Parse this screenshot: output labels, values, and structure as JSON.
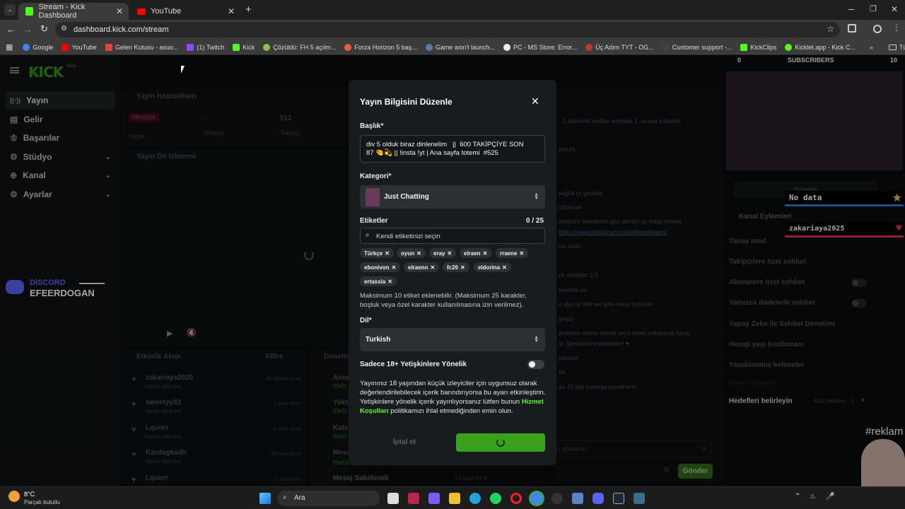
{
  "browser": {
    "tabs": [
      {
        "title": "Stream - Kick Dashboard",
        "active": true
      },
      {
        "title": "YouTube",
        "active": false
      }
    ],
    "url": "dashboard.kick.com/stream",
    "bookmarks": [
      "Google",
      "YouTube",
      "Gelen Kutusu - asuo...",
      "(1) Twitch",
      "Kick",
      "Çözüldü: FH 5 açılm...",
      "Forza Horizon 5 baş...",
      "Game won't launch...",
      "PC - MS Store: Error...",
      "Üç Adım TYT - OG...",
      "Customer support -...",
      "KickClips",
      "Kicklet.app - Kick C..."
    ],
    "all_bookmarks": "Tüm Yer İşaretleri"
  },
  "sidebar": {
    "logo": "KICK",
    "beta": "BETA",
    "items": [
      {
        "label": "Yayın",
        "icon": "stream-icon"
      },
      {
        "label": "Gelir",
        "icon": "revenue-icon"
      },
      {
        "label": "Başarılar",
        "icon": "trophy-icon"
      },
      {
        "label": "Stüdyo",
        "icon": "studio-icon"
      },
      {
        "label": "Kanal",
        "icon": "channel-icon"
      },
      {
        "label": "Ayarlar",
        "icon": "settings-icon"
      }
    ]
  },
  "stats": {
    "title": "Yayın İstatistikleri",
    "live_badge": "YAYINDA",
    "stream_label": "Yayın",
    "viewers_value": "-",
    "viewers_label": "İzleyici",
    "followers_value": "512",
    "followers_label": "Takipçi"
  },
  "preview": {
    "title": "Yayın Ön İzlemesi"
  },
  "overlay": {
    "discord_label": "DİSCORD",
    "discord_name": "EFEERDOGAN"
  },
  "activity": {
    "title": "Etkinlik Akışı",
    "filter": "Filtre",
    "events": [
      {
        "name": "zakariaya2025",
        "sub": "kanalı takip etti",
        "time": "26 dakika önce"
      },
      {
        "name": "sweetyy33",
        "sub": "kanalı takip etti",
        "time": "1 saat önce"
      },
      {
        "name": "Lquorr",
        "sub": "kanalı takip etti",
        "time": "2 saat önce"
      },
      {
        "name": "Kardagkadir",
        "sub": "kanalı takip etti",
        "time": "22 saat önce"
      },
      {
        "name": "Lquorr",
        "sub": "",
        "time": "1 dün önce"
      }
    ]
  },
  "audit": {
    "title": "Denetim",
    "rows": [
      {
        "name": "Anor",
        "sub": "EfeEr"
      },
      {
        "name": "Yekta",
        "sub": "EfeEr"
      },
      {
        "name": "Kateg",
        "sub": "EfeEr"
      },
      {
        "name": "Mesa",
        "sub": "EfeErdogan"
      },
      {
        "name": "Mesaj Sabitlendi",
        "sub": "",
        "time": "23 saat önce"
      }
    ]
  },
  "chat": {
    "gift_banner": "1 abonelik hediye edersek 1. sıraya yükselin",
    "lines": [
      "yorum",
      "sağlık iyi geceler",
      "izliyorum",
      "stagram hesabıma göz atmayı ve takip etmeyi",
      "https://www.instagram.com/efeerdogann/",
      "sin sado",
      "ok olmaktır 2.0",
      "teamda mı",
      "e diye bi film var john cena oynutoe",
      "geldü",
      "analıma abone olarak veya kicks yollayarak bana",
      "iz. Şimdiden teşekkürler! ♥",
      "yapıyor",
      "da",
      "da 25 kişi saldırsa sarsdnardı"
    ],
    "placeholder": "j gönderin",
    "send": "Gönder"
  },
  "right": {
    "sub_left": "0",
    "sub_title": "SUBSCRIBERS",
    "sub_right": "10",
    "edit_button": "Düzenle",
    "no_data": "No data",
    "overlay_user": "zakariaya2025",
    "channel_actions": "Kanal Eylemleri",
    "actions": [
      {
        "label": "Yavaş mod",
        "kind": "chevron"
      },
      {
        "label": "Takipçilere özel sohbet",
        "kind": "chevron"
      },
      {
        "label": "Abonelere özel sohbet",
        "kind": "toggle"
      },
      {
        "label": "Yalnızca ifadelerle sohbet",
        "kind": "toggle"
      },
      {
        "label": "Yapay Zeka ile Sohbet Denetimi",
        "kind": "chart"
      },
      {
        "label": "Hesap yaşı kısıtlaması",
        "kind": "chevron"
      },
      {
        "label": "Yasaklanmış kelimeler",
        "kind": "chevron"
      },
      {
        "label": "Hedefleri belirleyin",
        "kind": "chevron"
      }
    ],
    "blurred_item": "Ekranı Yakalama",
    "goal_status": "Aktif hedefler - 1",
    "reklam": "#reklam"
  },
  "modal": {
    "title": "Yayın Bilgisini Düzenle",
    "title_label": "Başlık*",
    "title_value_1": "div 5 olduk biraz dinlenelim   ||  600 TAKİPÇİYE SON",
    "title_value_2": "87 🤏💫 || !insta !yt | Ana sayfa totemi  #525",
    "category_label": "Kategori*",
    "category_value": "Just Chatting",
    "tags_label": "Etiketler",
    "tags_count": "0 / 25",
    "tags_placeholder": "Kendi etiketinizi seçin",
    "tags": [
      "Türkçe",
      "oyun",
      "eray",
      "elraen",
      "rraene",
      "ebonivon",
      "elraenn",
      "fc26",
      "eldorina",
      "ertassia"
    ],
    "tags_help": "Maksimum 10 etiket eklenebilir. (Maksimum 25 karakter, boşluk veya özel karakter kullanılmasına izin verilmez).",
    "language_label": "Dil*",
    "language_value": "Turkish",
    "adult_label": "Sadece 18+ Yetişkinlere Yönelik",
    "adult_text_1": "Yayınınız 18 yaşından küçük izleyiciler için uygunsuz olarak değerlendirilebilecek içerik barındırıyorsa bu ayarı etkinleştirin. Yetişkinlere yönelik içerik yayınlıyorsanız lütfen bunun ",
    "adult_link": "Hizmet Koşulları",
    "adult_text_2": " politikamızı ihlal etmediğinden emin olun.",
    "cancel": "İptal et"
  },
  "taskbar": {
    "temp": "8°C",
    "weather": "Parçalı bulutlu",
    "search": "Ara"
  },
  "colors": {
    "kick_green": "#53fc18",
    "accent_red": "#e0304e",
    "save_green": "#3aa11c"
  }
}
